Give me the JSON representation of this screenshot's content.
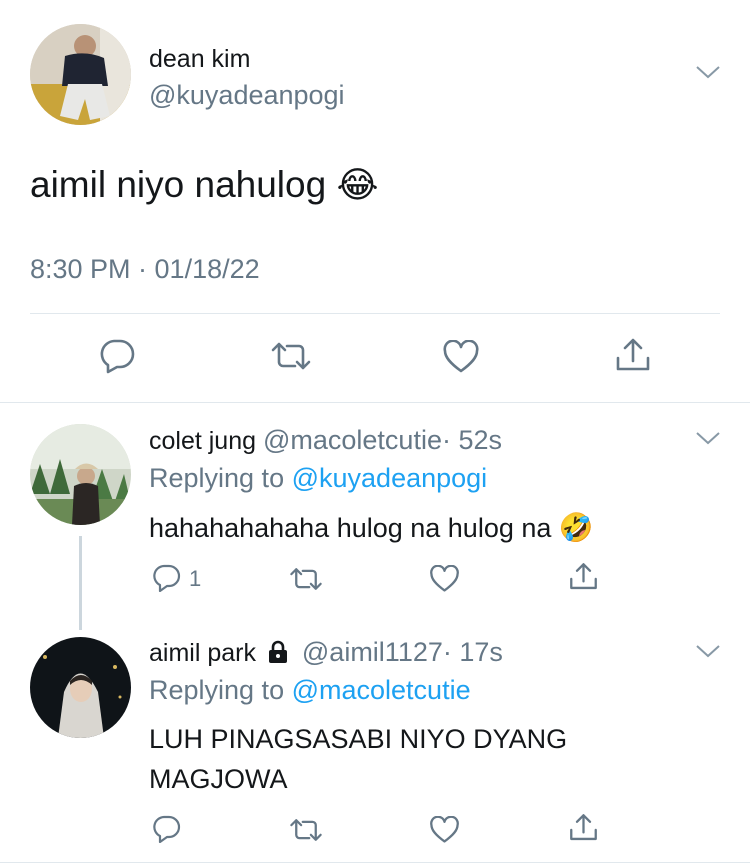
{
  "main_tweet": {
    "author_name": "dean kim",
    "author_handle": "@kuyadeanpogi",
    "text": "aimil niyo nahulog",
    "emoji": "😂",
    "timestamp": "8:30 PM · 01/18/22"
  },
  "replies": [
    {
      "author_name": "colet jung",
      "author_handle": "@macoletcutie",
      "time": "· 52s",
      "replying_prefix": "Replying to",
      "replying_to": "@kuyadeanpogi",
      "text": "hahahahahaha hulog na hulog na",
      "emoji": "🤣",
      "reply_count": "1",
      "locked": false
    },
    {
      "author_name": "aimil park",
      "author_handle": "@aimil1127",
      "time": "· 17s",
      "replying_prefix": "Replying to",
      "replying_to": "@macoletcutie",
      "text_line1": "LUH PINAGSASABI NIYO DYANG",
      "text_line2": "MAGJOWA",
      "locked": true
    }
  ],
  "colors": {
    "link": "#1da1f2",
    "secondary": "#657786",
    "divider": "#e1e8ed",
    "icon": "#657786"
  },
  "icons": [
    "chevron-down-icon",
    "reply-icon",
    "retweet-icon",
    "like-icon",
    "share-icon",
    "lock-icon"
  ]
}
